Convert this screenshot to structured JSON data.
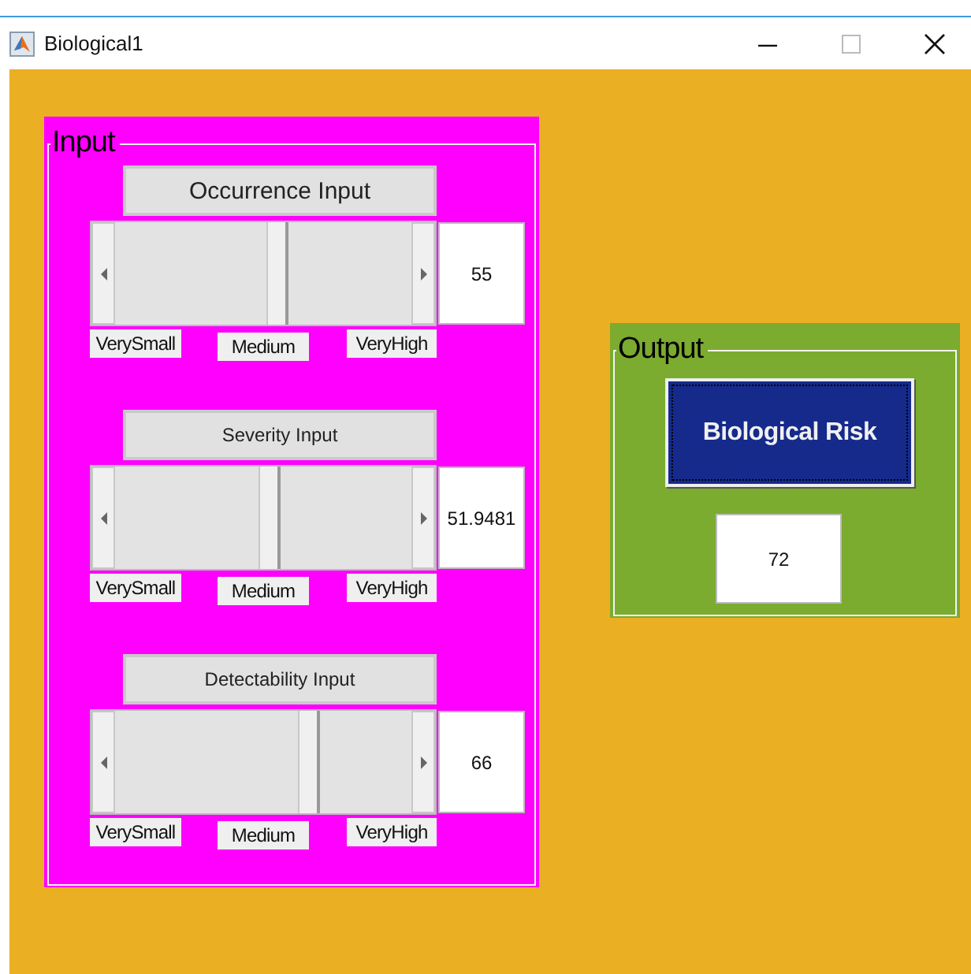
{
  "window": {
    "title": "Biological1"
  },
  "input_panel": {
    "title": "Input",
    "groups": [
      {
        "title": "Occurrence Input",
        "level": 0.55,
        "value": "55",
        "labels": [
          "VerySmall",
          "Medium",
          "VeryHigh"
        ]
      },
      {
        "title": "Severity Input",
        "level": 0.519481,
        "value": "51.9481",
        "labels": [
          "VerySmall",
          "Medium",
          "VeryHigh"
        ]
      },
      {
        "title": "Detectability Input",
        "level": 0.66,
        "value": "66",
        "labels": [
          "VerySmall",
          "Medium",
          "VeryHigh"
        ]
      }
    ]
  },
  "output_panel": {
    "title": "Output",
    "button": "Biological Risk",
    "value": "72"
  }
}
